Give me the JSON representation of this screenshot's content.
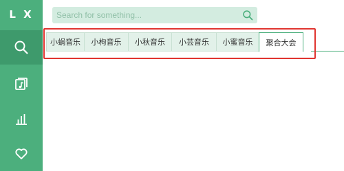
{
  "app": {
    "logo": "L X"
  },
  "sidebar": {
    "items": [
      {
        "name": "search",
        "icon": "search-icon",
        "active": true
      },
      {
        "name": "music",
        "icon": "music-file-icon",
        "active": false
      },
      {
        "name": "charts",
        "icon": "bar-chart-icon",
        "active": false
      },
      {
        "name": "favorites",
        "icon": "heart-icon",
        "active": false
      }
    ]
  },
  "search": {
    "placeholder": "Search for something..."
  },
  "tabs": [
    {
      "label": "小蜗音乐"
    },
    {
      "label": "小枸音乐"
    },
    {
      "label": "小秋音乐"
    },
    {
      "label": "小芸音乐"
    },
    {
      "label": "小蜜音乐"
    },
    {
      "label": "聚合大会",
      "active": true
    }
  ],
  "colors": {
    "accent": "#4caf7d",
    "sidebar_active": "#3e9a6c",
    "search_bg": "#d3ece0",
    "tab_bg": "#e2f1e9",
    "highlight": "#e0342f"
  }
}
